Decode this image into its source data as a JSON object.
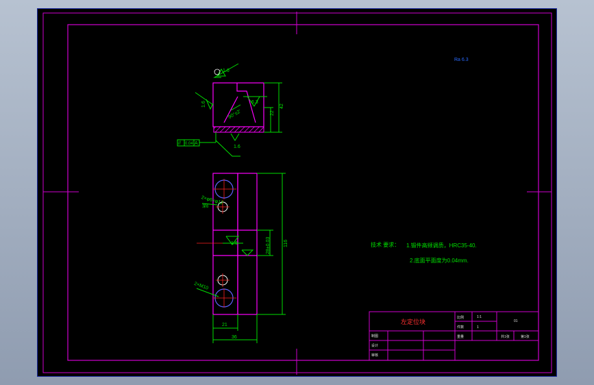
{
  "drawing": {
    "roughness_note": "Ra 6.3",
    "roughness": {
      "top": "1.6",
      "left": "1.6",
      "bottom": "1.6",
      "vee": "6.3",
      "plan": "1.6"
    },
    "dims": {
      "height_42": "42",
      "depth_22": "22",
      "angle": "90°±2'",
      "width_21": "21",
      "width_36": "36",
      "length_116": "116",
      "center_dim": "28±0.03"
    },
    "tolerance": {
      "symbol": "//",
      "value": "0.04",
      "datum": "A"
    },
    "holes": {
      "upper": "2×φ6×φ12",
      "upper_sub": "深6",
      "lower": "2×M10"
    },
    "tech_req": {
      "title": "技术 要求：",
      "line1": "1.锻件高频调质，HRC35-40.",
      "line2": "2.底面平面度为0.04mm."
    }
  },
  "title_block": {
    "part_name": "左定位块",
    "ratio_label": "比例",
    "ratio_value": "1:1",
    "qty_label": "件数",
    "qty_value": "1",
    "material_label": "重量",
    "sheet_label": "共1张",
    "sheet_value": "第1张",
    "drawn_label": "制图",
    "design_label": "设计",
    "check_label": "审核",
    "drawing_no": "01"
  }
}
